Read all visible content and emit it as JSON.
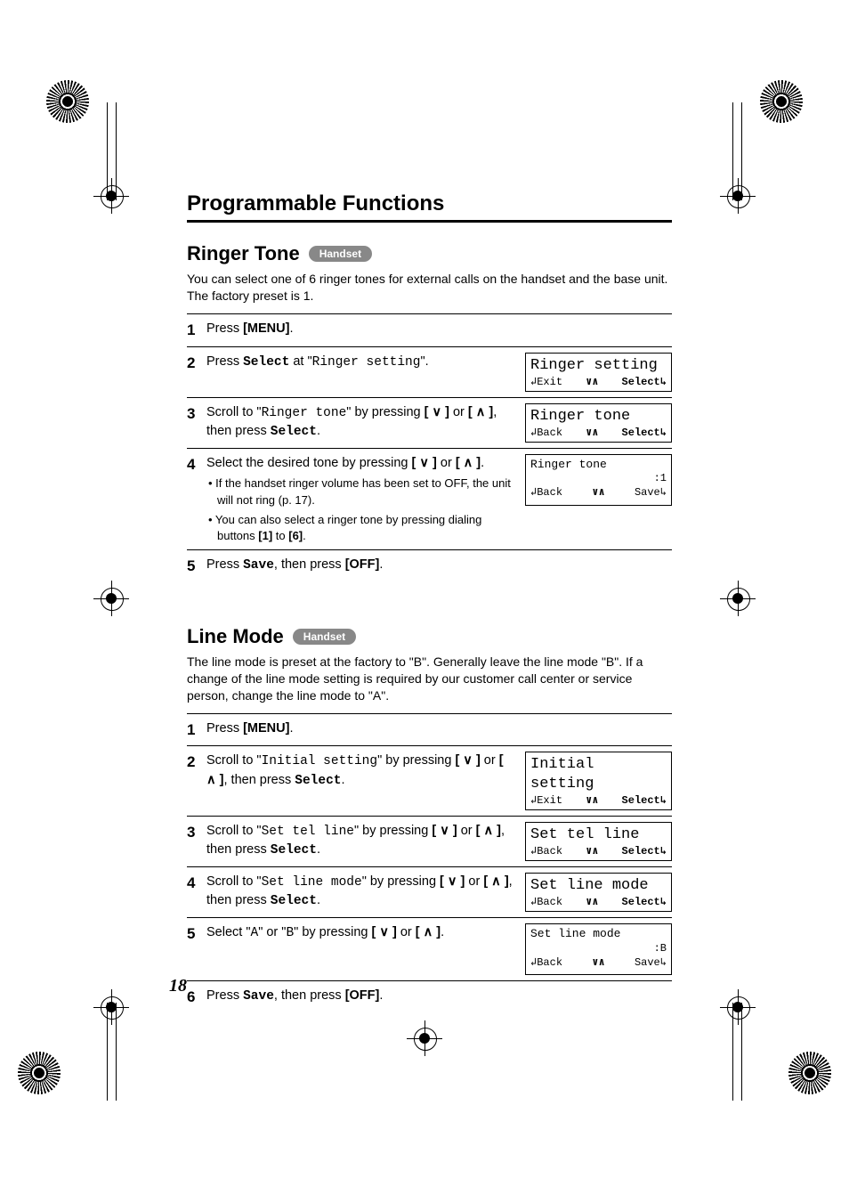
{
  "page_number": "18",
  "heading": "Programmable Functions",
  "ringer": {
    "title": "Ringer Tone",
    "badge": "Handset",
    "intro": "You can select one of 6 ringer tones for external calls on the handset and the base unit. The factory preset is 1.",
    "steps": {
      "s1": {
        "n": "1",
        "html": "Press <span class='bold'>[MENU]</span>."
      },
      "s2": {
        "n": "2",
        "html": "Press <span class='mono bold'>Select</span> at \"<span class='mono'>Ringer setting</span>\".",
        "screen": {
          "line1": "Ringer setting",
          "left": "↲Exit",
          "mid": "∨∧",
          "right": "Select↳",
          "rbold": true
        }
      },
      "s3": {
        "n": "3",
        "html": "Scroll to \"<span class='mono'>Ringer tone</span>\" by pressing <span class='bold'>[ ∨ ]</span> or <span class='bold'>[ ∧ ]</span>, then press <span class='mono bold'>Select</span>.",
        "screen": {
          "line1": "Ringer tone",
          "left": "↲Back",
          "mid": "∨∧",
          "right": "Select↳",
          "rbold": true
        }
      },
      "s4": {
        "n": "4",
        "html": "Select the desired tone by pressing <span class='bold'>[ ∨ ]</span> or <span class='bold'>[ ∧ ]</span>.",
        "sub1": "• If the handset ringer volume has been set to OFF, the unit will not ring (p. 17).",
        "sub2": "• You can also select a ringer tone by pressing dialing buttons <b>[1]</b> to <b>[6]</b>.",
        "screen": {
          "line1_small": "Ringer tone",
          "value": ":1",
          "left": "↲Back",
          "mid": "∨∧",
          "right": "Save↳",
          "rbold": false
        }
      },
      "s5": {
        "n": "5",
        "html": "Press <span class='mono bold'>Save</span>, then press <span class='bold'>[OFF]</span>."
      }
    }
  },
  "line": {
    "title": "Line Mode",
    "badge": "Handset",
    "intro": "The line mode is preset at the factory to \"B\". Generally leave the line mode \"B\". If a change of the line mode setting is required by our customer call center or service person, change the line mode to \"A\".",
    "steps": {
      "s1": {
        "n": "1",
        "html": "Press <span class='bold'>[MENU]</span>."
      },
      "s2": {
        "n": "2",
        "html": "Scroll to \"<span class='mono'>Initial setting</span>\" by pressing <span class='bold'>[ ∨ ]</span> or <span class='bold'>[ ∧ ]</span>, then press <span class='mono bold'>Select</span>.",
        "screen": {
          "line1": "Initial setting",
          "left": "↲Exit",
          "mid": "∨∧",
          "right": "Select↳",
          "rbold": true
        }
      },
      "s3": {
        "n": "3",
        "html": "Scroll to \"<span class='mono'>Set tel line</span>\" by pressing <span class='bold'>[ ∨ ]</span> or <span class='bold'>[ ∧ ]</span>, then press <span class='mono bold'>Select</span>.",
        "screen": {
          "line1": "Set tel line",
          "left": "↲Back",
          "mid": "∨∧",
          "right": "Select↳",
          "rbold": true
        }
      },
      "s4": {
        "n": "4",
        "html": "Scroll to \"<span class='mono'>Set line mode</span>\" by pressing <span class='bold'>[ ∨ ]</span> or <span class='bold'>[ ∧ ]</span>, then press <span class='mono bold'>Select</span>.",
        "screen": {
          "line1": "Set line mode",
          "left": "↲Back",
          "mid": "∨∧",
          "right": "Select↳",
          "rbold": true
        }
      },
      "s5": {
        "n": "5",
        "html": "Select \"<span class='mono'>A</span>\" or \"<span class='mono'>B</span>\" by pressing <span class='bold'>[ ∨ ]</span> or <span class='bold'>[ ∧ ]</span>.",
        "screen": {
          "line1_small": "Set line mode",
          "value": ":B",
          "left": "↲Back",
          "mid": "∨∧",
          "right": "Save↳",
          "rbold": false
        }
      },
      "s6": {
        "n": "6",
        "html": "Press <span class='mono bold'>Save</span>, then press <span class='bold'>[OFF]</span>."
      }
    }
  }
}
